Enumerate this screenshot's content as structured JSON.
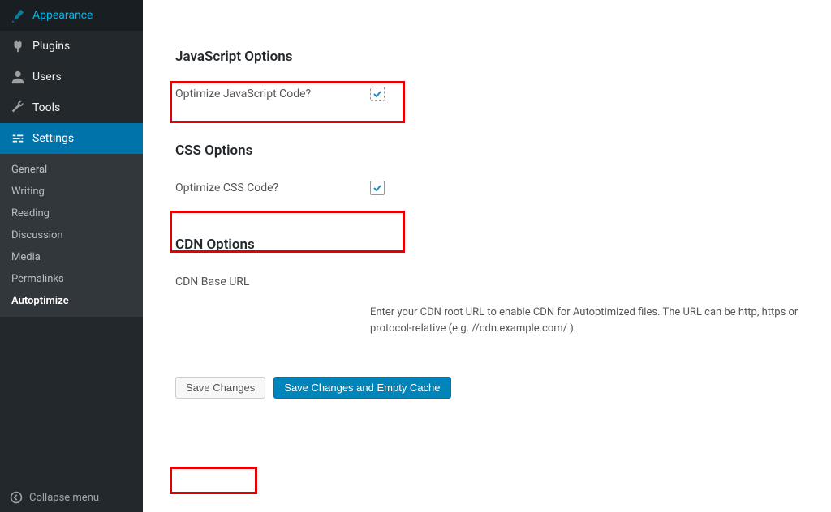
{
  "sidebar": {
    "items": [
      {
        "label": "Appearance"
      },
      {
        "label": "Plugins"
      },
      {
        "label": "Users"
      },
      {
        "label": "Tools"
      },
      {
        "label": "Settings"
      }
    ],
    "submenu": [
      {
        "label": "General"
      },
      {
        "label": "Writing"
      },
      {
        "label": "Reading"
      },
      {
        "label": "Discussion"
      },
      {
        "label": "Media"
      },
      {
        "label": "Permalinks"
      },
      {
        "label": "Autoptimize"
      }
    ],
    "collapse": "Collapse menu"
  },
  "sections": {
    "js": {
      "heading": "JavaScript Options",
      "optimize_label": "Optimize JavaScript Code?"
    },
    "css": {
      "heading": "CSS Options",
      "optimize_label": "Optimize CSS Code?"
    },
    "cdn": {
      "heading": "CDN Options",
      "base_url_label": "CDN Base URL",
      "help": "Enter your CDN root URL to enable CDN for Autoptimized files. The URL can be http, https or protocol-relative (e.g. //cdn.example.com/ )."
    }
  },
  "buttons": {
    "save": "Save Changes",
    "save_empty": "Save Changes and Empty Cache"
  }
}
